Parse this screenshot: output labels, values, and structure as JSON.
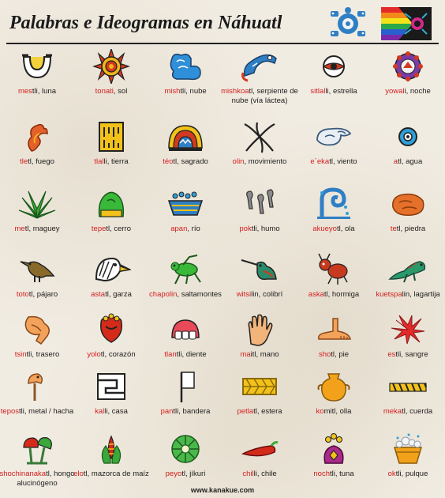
{
  "header": {
    "title": "Palabras e Ideogramas en Náhuatl"
  },
  "footer": {
    "site": "www.kanakue.com"
  },
  "colors": {
    "stem": "#d42020",
    "text": "#1e1e1e",
    "paper": "#f1ece2"
  },
  "glyphs": [
    {
      "stem": "mes",
      "rest": "tli, luna",
      "icon": "moon-glyph-icon"
    },
    {
      "stem": "tonati",
      "rest": ", sol",
      "icon": "sun-glyph-icon"
    },
    {
      "stem": "mish",
      "rest": "tli, nube",
      "icon": "cloud-glyph-icon"
    },
    {
      "stem": "mishkoa",
      "rest": "tl, serpiente de nube (vía láctea)",
      "icon": "cloud-serpent-glyph-icon"
    },
    {
      "stem": "sitlal",
      "rest": "li, estrella",
      "icon": "star-glyph-icon"
    },
    {
      "stem": "yowal",
      "rest": "i, noche",
      "icon": "night-glyph-icon"
    },
    {
      "stem": "tle",
      "rest": "tl, fuego",
      "icon": "fire-glyph-icon"
    },
    {
      "stem": "tlal",
      "rest": "li, tierra",
      "icon": "earth-glyph-icon"
    },
    {
      "stem": "téo",
      "rest": "tl, sagrado",
      "icon": "sacred-glyph-icon"
    },
    {
      "stem": "olin",
      "rest": ", movimiento",
      "icon": "movement-glyph-icon"
    },
    {
      "stem": "e´eka",
      "rest": "tl, viento",
      "icon": "wind-glyph-icon"
    },
    {
      "stem": "a",
      "rest": "tl, agua",
      "icon": "water-glyph-icon"
    },
    {
      "stem": "me",
      "rest": "tl, maguey",
      "icon": "maguey-glyph-icon"
    },
    {
      "stem": "tepe",
      "rest": "tl, cerro",
      "icon": "hill-glyph-icon"
    },
    {
      "stem": "apan",
      "rest": ", río",
      "icon": "river-glyph-icon"
    },
    {
      "stem": "pok",
      "rest": "tli, humo",
      "icon": "smoke-glyph-icon"
    },
    {
      "stem": "akueyo",
      "rest": "tl, ola",
      "icon": "wave-glyph-icon"
    },
    {
      "stem": "te",
      "rest": "tl, piedra",
      "icon": "stone-glyph-icon"
    },
    {
      "stem": "toto",
      "rest": "tl, pájaro",
      "icon": "bird-glyph-icon"
    },
    {
      "stem": "asta",
      "rest": "tl, garza",
      "icon": "heron-glyph-icon"
    },
    {
      "stem": "chapolin",
      "rest": ", saltamontes",
      "icon": "grasshopper-glyph-icon"
    },
    {
      "stem": "witsi",
      "rest": "lin, colibrí",
      "icon": "hummingbird-glyph-icon"
    },
    {
      "stem": "aska",
      "rest": "tl, hormiga",
      "icon": "ant-glyph-icon"
    },
    {
      "stem": "kuetspa",
      "rest": "lin, lagartija",
      "icon": "lizard-glyph-icon"
    },
    {
      "stem": "tsin",
      "rest": "tli, trasero",
      "icon": "buttocks-glyph-icon"
    },
    {
      "stem": "yolo",
      "rest": "tl, corazón",
      "icon": "heart-glyph-icon"
    },
    {
      "stem": "tlan",
      "rest": "tli, diente",
      "icon": "tooth-glyph-icon"
    },
    {
      "stem": "ma",
      "rest": "itl, mano",
      "icon": "hand-glyph-icon"
    },
    {
      "stem": "sho",
      "rest": "tl, pie",
      "icon": "foot-glyph-icon"
    },
    {
      "stem": "es",
      "rest": "tli, sangre",
      "icon": "blood-glyph-icon"
    },
    {
      "stem": "tepos",
      "rest": "tli, metal / hacha",
      "icon": "axe-glyph-icon"
    },
    {
      "stem": "kal",
      "rest": "li, casa",
      "icon": "house-glyph-icon"
    },
    {
      "stem": "pan",
      "rest": "tli, bandera",
      "icon": "flag-glyph-icon"
    },
    {
      "stem": "petla",
      "rest": "tl, estera",
      "icon": "mat-glyph-icon"
    },
    {
      "stem": "ko",
      "rest": "mitl, olla",
      "icon": "pot-glyph-icon"
    },
    {
      "stem": "meka",
      "rest": "tl, cuerda",
      "icon": "rope-glyph-icon"
    },
    {
      "stem": "shochinanaka",
      "rest": "tl, hongo alucinógeno",
      "icon": "mushroom-glyph-icon"
    },
    {
      "stem": "elo",
      "rest": "tl, mazorca de maíz",
      "icon": "corn-glyph-icon"
    },
    {
      "stem": "peyo",
      "rest": "tl, jíkuri",
      "icon": "peyote-glyph-icon"
    },
    {
      "stem": "chil",
      "rest": "li, chile",
      "icon": "chili-glyph-icon"
    },
    {
      "stem": "noch",
      "rest": "tli, tuna",
      "icon": "prickly-pear-glyph-icon"
    },
    {
      "stem": "ok",
      "rest": "tli, pulque",
      "icon": "pulque-glyph-icon"
    }
  ]
}
